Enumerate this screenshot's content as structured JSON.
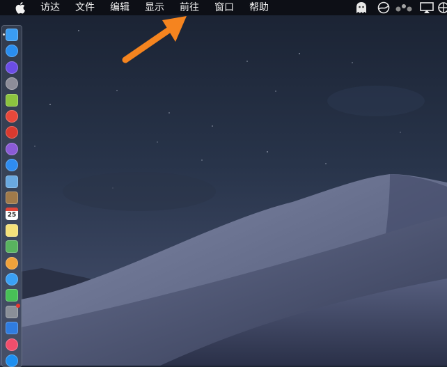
{
  "menubar": {
    "apple_icon": "apple-logo-icon",
    "items": [
      {
        "label": "访达"
      },
      {
        "label": "文件"
      },
      {
        "label": "编辑"
      },
      {
        "label": "显示"
      },
      {
        "label": "前往"
      },
      {
        "label": "窗口"
      },
      {
        "label": "帮助"
      }
    ],
    "status_icons": [
      "ghost-icon",
      "network-globe-icon",
      "dots-icon",
      "screen-mirroring-icon",
      "language-icon"
    ]
  },
  "dock": {
    "apps": [
      {
        "name": "finder-icon",
        "color": "#3a9cf2",
        "running": true
      },
      {
        "name": "app-store-icon",
        "color": "#2a8ef0"
      },
      {
        "name": "siri-icon",
        "color": "#6b4de6"
      },
      {
        "name": "launchpad-icon",
        "color": "#8d8d99"
      },
      {
        "name": "android-icon",
        "color": "#8cc33f"
      },
      {
        "name": "pinwheel-icon",
        "color": "#e8483b"
      },
      {
        "name": "red-app-icon",
        "color": "#d93a2f"
      },
      {
        "name": "purple-app-icon",
        "color": "#8b5bd6"
      },
      {
        "name": "safari-icon",
        "color": "#2f8cf0"
      },
      {
        "name": "preview-icon",
        "color": "#6aa9e0"
      },
      {
        "name": "notebook-icon",
        "color": "#a07a4a"
      },
      {
        "name": "calendar-icon",
        "color": "#ffffff"
      },
      {
        "name": "notes-icon",
        "color": "#f5e17a"
      },
      {
        "name": "maps-icon",
        "color": "#59b35f"
      },
      {
        "name": "photos-icon",
        "color": "#f0a23b"
      },
      {
        "name": "messages-icon",
        "color": "#3aa0f5"
      },
      {
        "name": "facetime-icon",
        "color": "#48c057"
      },
      {
        "name": "system-preferences-icon",
        "color": "#8a8f98"
      },
      {
        "name": "keynote-icon",
        "color": "#2f7ce0"
      },
      {
        "name": "music-icon",
        "color": "#f14e6c"
      },
      {
        "name": "app-store-2-icon",
        "color": "#1e8ff0"
      }
    ],
    "calendar_day": "25"
  },
  "annotation": {
    "arrow_color": "#f5841f"
  }
}
